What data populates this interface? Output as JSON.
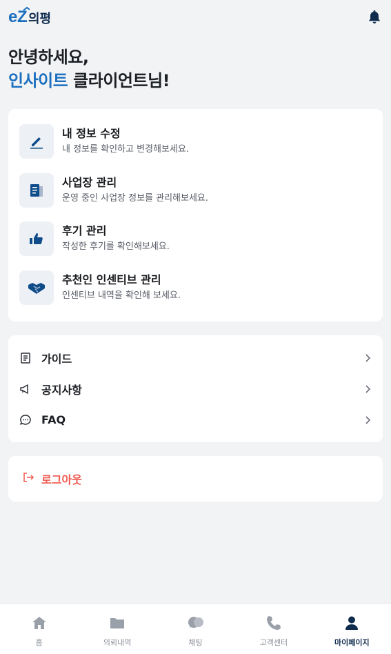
{
  "header": {
    "logo_text": "ez의평",
    "bell_icon": "bell-icon"
  },
  "greeting": {
    "line1": "안녕하세요,",
    "brand": "인사이트",
    "line2_rest": " 클라이언트님!"
  },
  "profile_menu": [
    {
      "title": "내 정보 수정",
      "desc": "내 정보를 확인하고 변경해보세요.",
      "icon": "edit-icon"
    },
    {
      "title": "사업장 관리",
      "desc": "운영 중인 사업장 정보를 관리해보세요.",
      "icon": "document-icon"
    },
    {
      "title": "후기 관리",
      "desc": "작성한 후기를 확인해보세요.",
      "icon": "thumbs-up-icon"
    },
    {
      "title": "추천인 인센티브 관리",
      "desc": "인센티브 내역을 확인해 보세요.",
      "icon": "handshake-icon"
    }
  ],
  "links": [
    {
      "label": "가이드",
      "icon": "guide-icon"
    },
    {
      "label": "공지사항",
      "icon": "megaphone-icon"
    },
    {
      "label": "FAQ",
      "icon": "chat-question-icon"
    }
  ],
  "logout": {
    "label": "로그아웃",
    "icon": "logout-icon"
  },
  "tabs": [
    {
      "label": "홈",
      "icon": "home-icon"
    },
    {
      "label": "의뢰내역",
      "icon": "folder-icon"
    },
    {
      "label": "채팅",
      "icon": "chat-icon"
    },
    {
      "label": "고객센터",
      "icon": "phone-icon"
    },
    {
      "label": "마이페이지",
      "icon": "user-icon",
      "active": true
    }
  ],
  "colors": {
    "brand_blue": "#1b6fbf",
    "navy": "#0f2c4d",
    "logout_red": "#f0584f",
    "background": "#f2f3f5"
  }
}
